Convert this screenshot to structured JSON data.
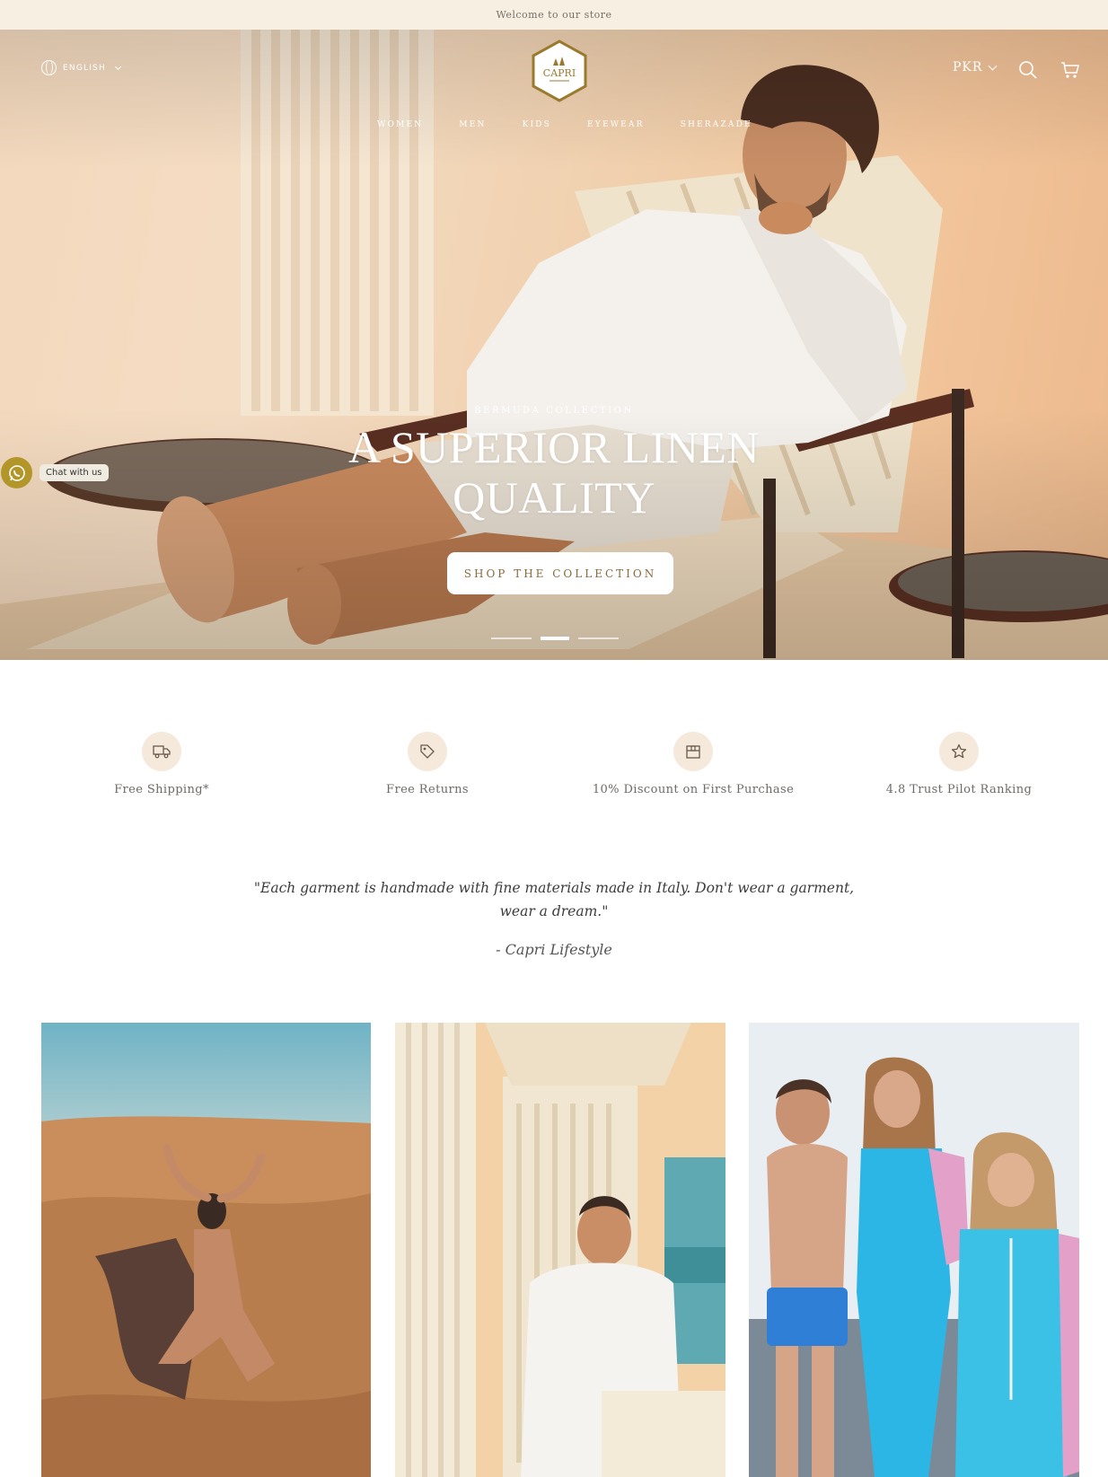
{
  "announcement": "Welcome to our store",
  "header": {
    "language": "English",
    "logo_text": "CAPRI",
    "currency": "PKR",
    "nav": [
      "Women",
      "Men",
      "Kids",
      "Eyewear",
      "Sherazade"
    ]
  },
  "hero": {
    "subtitle": "BERMUDA COLLECTION",
    "title_line1": "A SUPERIOR LINEN",
    "title_line2": "QUALITY",
    "cta": "SHOP THE COLLECTION",
    "slides": 3,
    "active_slide": 2
  },
  "chat": {
    "label": "Chat with us"
  },
  "features": [
    {
      "icon": "truck-icon",
      "label": "Free Shipping*"
    },
    {
      "icon": "tag-icon",
      "label": "Free Returns"
    },
    {
      "icon": "gift-box-icon",
      "label": "10% Discount on First Purchase"
    },
    {
      "icon": "star-icon",
      "label": "4.8 Trust Pilot Ranking"
    }
  ],
  "quote": {
    "text": "\"Each garment is handmade with fine materials made in Italy. Don't wear a garment, wear a dream.\"",
    "author": "- Capri Lifestyle"
  },
  "colors": {
    "announcement_bg": "#f6efe2",
    "accent_gold": "#b3962a",
    "feature_icon_bg": "#f4e9da"
  }
}
